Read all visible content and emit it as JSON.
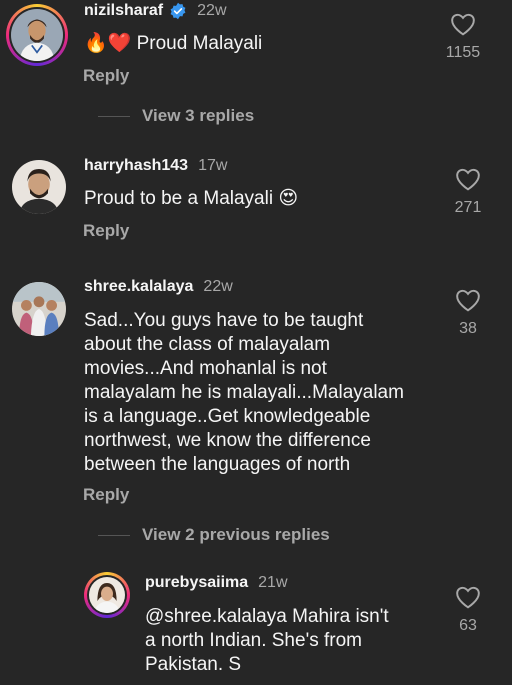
{
  "comments": [
    {
      "username": "nizilsharaf",
      "time": "22w",
      "text": "Proud Malayali",
      "emoji": "🔥❤️",
      "likes": "1155",
      "reply_label": "Reply",
      "verified": true
    },
    {
      "username": "harryhash143",
      "time": "17w",
      "text": "Proud to be a Malayali 😍",
      "likes": "271",
      "reply_label": "Reply"
    },
    {
      "username": "shree.kalalaya",
      "time": "22w",
      "text_lines": [
        "Sad...You guys have to be taught",
        "about the class of malayalam",
        "movies...And mohanlal is not",
        "malayalam he is malayali...Malayalam",
        "is a language..Get knowledgeable",
        "northwest, we know the difference",
        "between the languages of north"
      ],
      "likes": "38",
      "reply_label": "Reply"
    },
    {
      "username": "purebysaiima",
      "time": "21w",
      "text_lines": [
        "@shree.kalalaya Mahira isn't",
        "a north Indian. She's from",
        "Pakistan. S"
      ],
      "likes": "63"
    }
  ],
  "view_replies_1": "View 3 replies",
  "view_replies_2": "View 2 previous replies",
  "icons": {
    "like": "heart-outline-icon",
    "verified": "verified-badge-icon"
  }
}
